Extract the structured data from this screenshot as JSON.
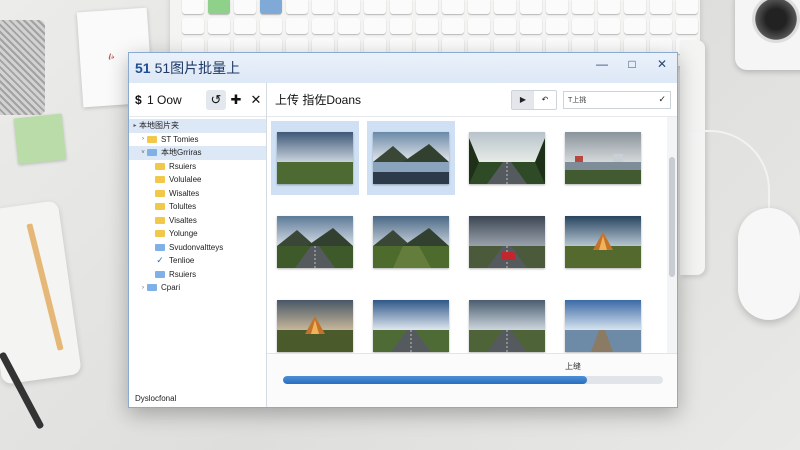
{
  "window": {
    "app_icon": "51",
    "title": "51图片批量上",
    "controls": [
      "minimize-icon",
      "maximize-icon",
      "close-icon"
    ]
  },
  "sidebar": {
    "title_symbol": "$",
    "title": "1 Oow",
    "tools": [
      "refresh-icon",
      "add-icon",
      "close-icon"
    ],
    "tree": [
      {
        "label": "本地图片夹",
        "indent": 0,
        "icon": "expand-arrow",
        "selected": true
      },
      {
        "label": "ST Tomies",
        "indent": 1,
        "icon": "yellow-folder",
        "twisty": "›"
      },
      {
        "label": "本地Grriras",
        "indent": 1,
        "icon": "blue-folder",
        "twisty": "˅",
        "selected": true
      },
      {
        "label": "Rsuiers",
        "indent": 2,
        "icon": "yellow-folder"
      },
      {
        "label": "Volulalee",
        "indent": 2,
        "icon": "yellow-folder"
      },
      {
        "label": "Wisaltes",
        "indent": 2,
        "icon": "yellow-folder"
      },
      {
        "label": "Tolultes",
        "indent": 2,
        "icon": "yellow-folder"
      },
      {
        "label": "Visaltes",
        "indent": 2,
        "icon": "yellow-folder"
      },
      {
        "label": "Yolunge",
        "indent": 2,
        "icon": "yellow-folder"
      },
      {
        "label": "Svudonvaltteys",
        "indent": 2,
        "icon": "blue-folder"
      },
      {
        "label": "Tenlioe",
        "indent": 2,
        "icon": "check"
      },
      {
        "label": "Rsuiers",
        "indent": 2,
        "icon": "blue-folder"
      },
      {
        "label": "Cpari",
        "indent": 1,
        "icon": "blue-folder",
        "twisty": "›"
      }
    ],
    "footer": "Dyslocfonal"
  },
  "main": {
    "title": "上传 指佐Doans",
    "nav": [
      "play-icon",
      "back-icon"
    ],
    "search_text": "T上挑",
    "search_icon": "check-icon",
    "thumbnails": [
      {
        "scene": "field-horizon",
        "selected": true
      },
      {
        "scene": "mountain-lake",
        "selected": true
      },
      {
        "scene": "forest-road",
        "selected": false
      },
      {
        "scene": "lakeside-houses",
        "selected": false
      },
      {
        "scene": "mountain-road",
        "selected": false
      },
      {
        "scene": "green-valley",
        "selected": false
      },
      {
        "scene": "road-red-car",
        "selected": false
      },
      {
        "scene": "field-tent",
        "selected": false
      },
      {
        "scene": "field-tent-dusk",
        "selected": false
      },
      {
        "scene": "sky-road",
        "selected": false
      },
      {
        "scene": "wide-road",
        "selected": false
      },
      {
        "scene": "lake-pier",
        "selected": false
      }
    ],
    "progress": {
      "label": "上缝",
      "percent": 80
    }
  },
  "desk": {
    "notepad_scribble": "𝓉𝓈"
  }
}
